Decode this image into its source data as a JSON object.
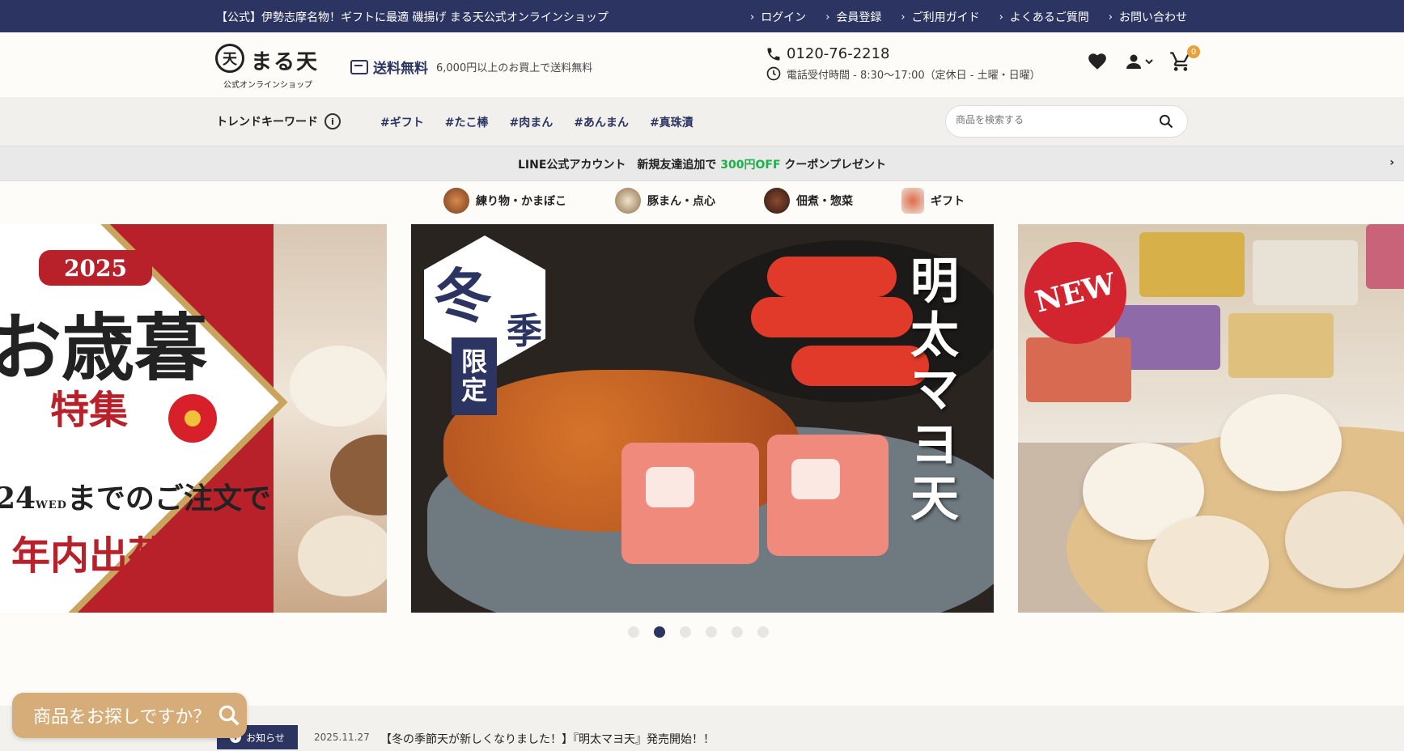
{
  "topbar": {
    "message": "【公式】伊勢志摩名物！ギフトに最適 磯揚げ まる天公式オンラインショップ",
    "links": [
      "ログイン",
      "会員登録",
      "ご利用ガイド",
      "よくあるご質問",
      "お問い合わせ"
    ]
  },
  "header": {
    "logo_mark": "天",
    "logo_name": "まる天",
    "logo_sub": "公式オンラインショップ",
    "shipping_title": "送料無料",
    "shipping_condition": "6,000円以上のお買上で送料無料",
    "phone": "0120-76-2218",
    "hours": "電話受付時間 - 8:30〜17:00（定休日 - 土曜・日曜）",
    "cart_count": "0"
  },
  "trend": {
    "label": "トレンドキーワード",
    "tags": [
      "#ギフト",
      "#たこ棒",
      "#肉まん",
      "#あんまん",
      "#真珠漬"
    ],
    "search_placeholder": "商品を検索する"
  },
  "line_banner": {
    "prefix": "LINE公式アカウント　新規友達追加で ",
    "highlight": "300円OFF",
    "suffix": " クーポンプレゼント"
  },
  "categories": [
    {
      "label": "練り物・かまぼこ",
      "color": "#b86f3c"
    },
    {
      "label": "豚まん・点心",
      "color": "#c9a67a"
    },
    {
      "label": "佃煮・惣菜",
      "color": "#6b3a28"
    },
    {
      "label": "ギフト",
      "color": "#d44a3a"
    }
  ],
  "slides": {
    "oseibo": {
      "year": "2025",
      "title": "お歳暮",
      "subtitle": "特集",
      "deadline_day": "24",
      "deadline_dow": "WED",
      "deadline_text": "までのご注文で",
      "shipping": "年内出荷"
    },
    "mentai": {
      "season": "冬",
      "season2": "季",
      "limited": [
        "限",
        "定"
      ],
      "title": [
        "明",
        "太",
        "マ",
        "ヨ",
        "天"
      ]
    },
    "newbuns": {
      "badge": "NEW"
    }
  },
  "carousel": {
    "count": 6,
    "active": 1
  },
  "news": {
    "tag": "お知らせ",
    "date": "2025.11.27",
    "title": "【冬の季節天が新しくなりました！】『明太マヨ天』発売開始！！"
  },
  "finder_label": "商品をお探しですか？"
}
